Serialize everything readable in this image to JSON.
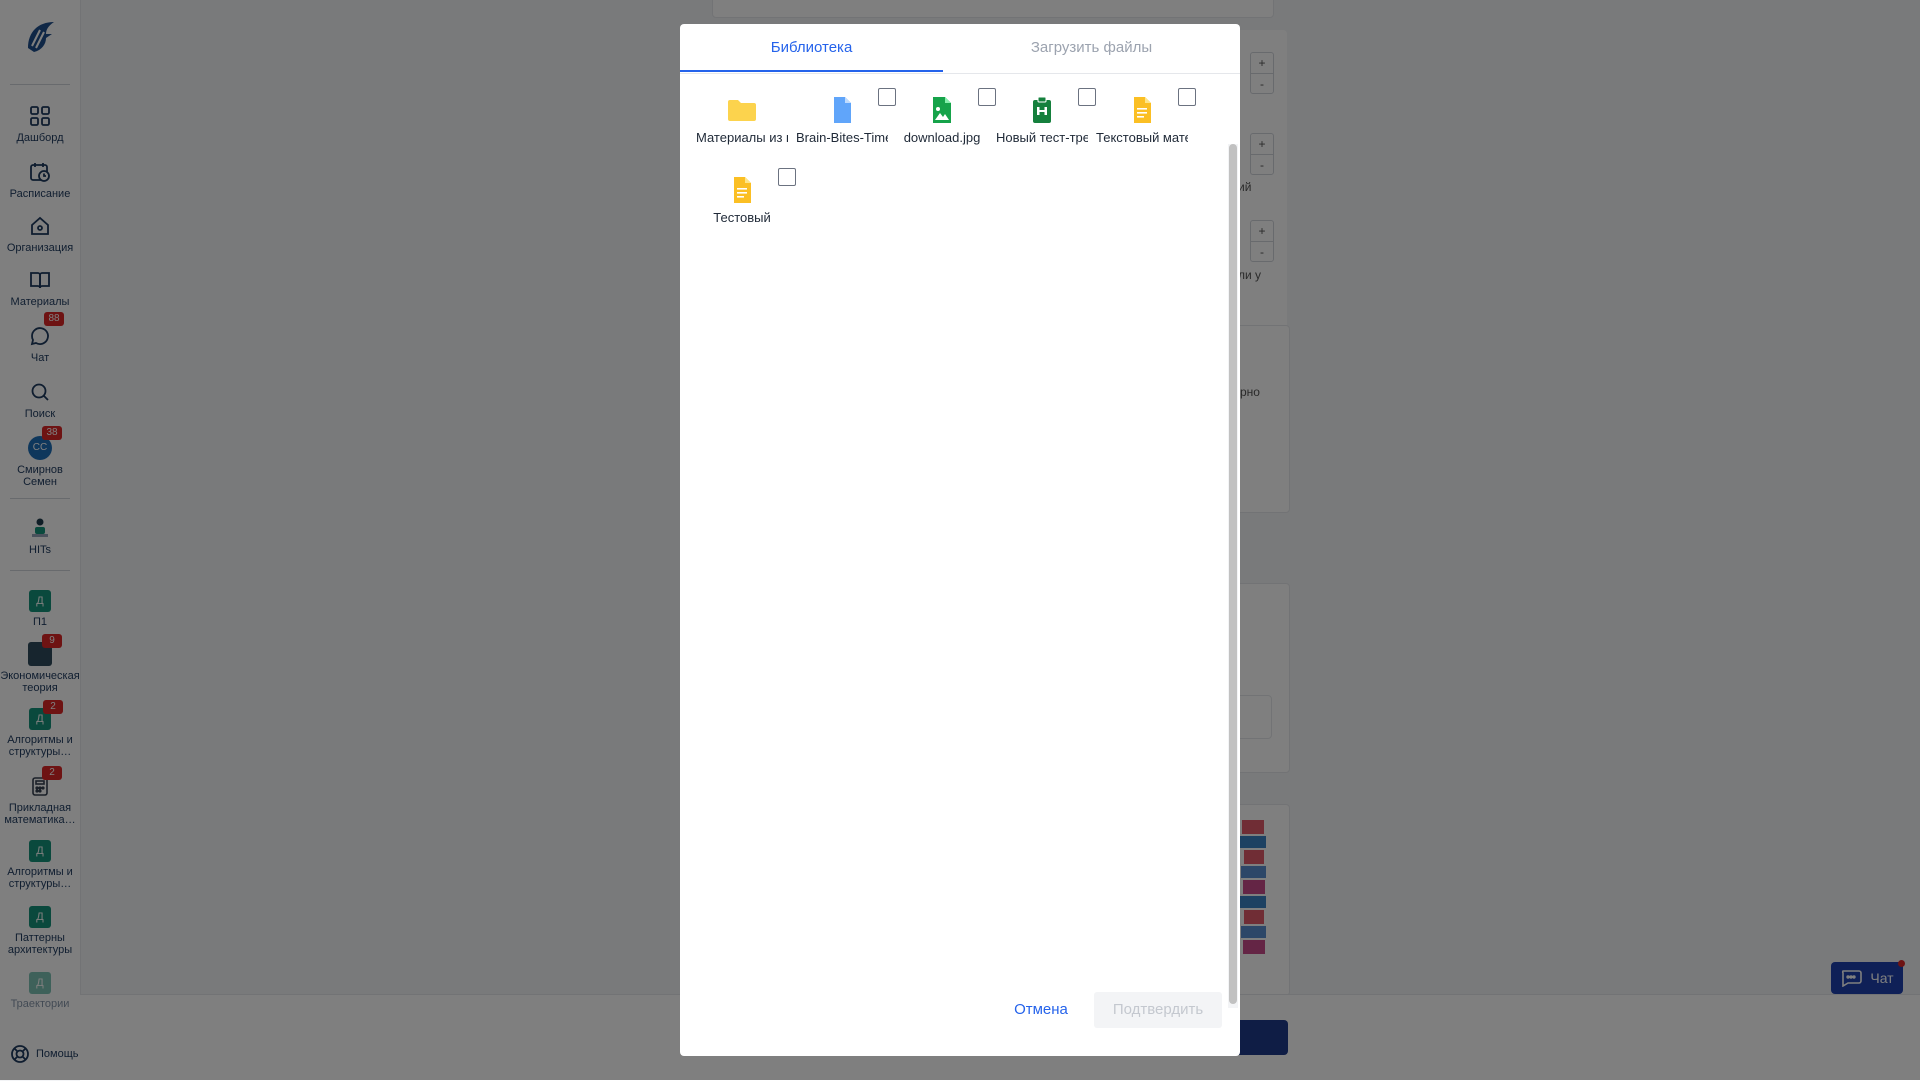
{
  "sidebar": {
    "items": [
      {
        "label": "Дашборд",
        "icon": "grid-icon"
      },
      {
        "label": "Расписание",
        "icon": "calendar-clock-icon"
      },
      {
        "label": "Организация",
        "icon": "home-icon"
      },
      {
        "label": "Материалы",
        "icon": "book-icon"
      },
      {
        "label": "Чат",
        "icon": "chat-icon",
        "badge": "88"
      },
      {
        "label": "Поиск",
        "icon": "search-icon"
      },
      {
        "label": "Смирнов Семен",
        "avatar": "СС",
        "badge": "38"
      }
    ],
    "hits_label": "HITs",
    "courses": [
      {
        "label": "П1",
        "avatar": "Д"
      },
      {
        "label": "Экономическая теория",
        "badge": "9"
      },
      {
        "label": "Алгоритмы и структуры…",
        "avatar": "Д",
        "badge": "2"
      },
      {
        "label": "Прикладная математика…",
        "badge": "2"
      },
      {
        "label": "Алгоритмы и структуры…",
        "avatar": "Д"
      },
      {
        "label": "Паттерны архитектуры",
        "avatar": "Д"
      },
      {
        "label": "Траектории",
        "avatar": "Д"
      }
    ],
    "help_label": "Помощь"
  },
  "background": {
    "snippets": [
      "ий",
      "сли у",
      "рно"
    ],
    "stepper_plus": "+",
    "stepper_minus": "-",
    "chat_widget_label": "Чат"
  },
  "modal": {
    "tabs": [
      {
        "label": "Библиотека",
        "active": true
      },
      {
        "label": "Загрузить файлы",
        "active": false
      }
    ],
    "files": [
      {
        "name": "Материалы из курса",
        "icon": "folder-icon",
        "color": "#fcd34d",
        "checkbox": false
      },
      {
        "name": "Brain-Bites-Time",
        "icon": "document-icon",
        "color": "#60a5fa",
        "checkbox": true
      },
      {
        "name": "download.jpg",
        "icon": "image-file-icon",
        "color": "#16a34a",
        "checkbox": true
      },
      {
        "name": "Новый тест-тренажер",
        "icon": "test-file-icon",
        "color": "#15803d",
        "checkbox": true
      },
      {
        "name": "Текстовый материал",
        "icon": "text-file-icon",
        "color": "#fbbf24",
        "checkbox": true
      },
      {
        "name": "Тестовый",
        "icon": "text-file-icon",
        "color": "#fbbf24",
        "checkbox": true
      }
    ],
    "cancel_label": "Отмена",
    "confirm_label": "Подтвердить"
  },
  "colors": {
    "accent": "#2563eb",
    "overlay": "rgba(0,0,0,0.5)",
    "badge": "#dc2626",
    "course_avatar": "#14937a"
  }
}
